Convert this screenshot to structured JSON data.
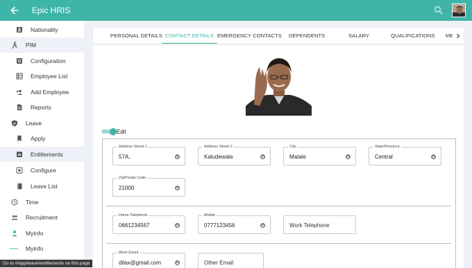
{
  "app": {
    "title": "Epic HRIS"
  },
  "sidebar": {
    "items": [
      {
        "label": "Nationality",
        "icon": "badge-icon",
        "level": 2
      },
      {
        "label": "PIM",
        "icon": "person-walk-icon",
        "level": 1
      },
      {
        "label": "Configuration",
        "icon": "settings-box-icon",
        "level": 2
      },
      {
        "label": "Employee List",
        "icon": "list-icon",
        "level": 2
      },
      {
        "label": "Add Employee",
        "icon": "person-add-icon",
        "level": 2
      },
      {
        "label": "Reports",
        "icon": "document-icon",
        "level": 2
      },
      {
        "label": "Leave",
        "icon": "shield-check-icon",
        "level": 1
      },
      {
        "label": "Apply",
        "icon": "bookmark-icon",
        "level": 2
      },
      {
        "label": "Entitlements",
        "icon": "bar-chart-icon",
        "level": 2
      },
      {
        "label": "Configure",
        "icon": "settings-box-icon",
        "level": 2
      },
      {
        "label": "Leave List",
        "icon": "book-icon",
        "level": 2
      },
      {
        "label": "Time",
        "icon": "clock-icon",
        "level": 1
      },
      {
        "label": "Recruitment",
        "icon": "people-icon",
        "level": 1
      },
      {
        "label": "MyInfo",
        "icon": "person-icon",
        "level": 1
      },
      {
        "label": "MyInfo",
        "icon": "dash-icon",
        "level": 2
      }
    ]
  },
  "status_bar": {
    "text": "Go to #/app/leave/entitlements on this page"
  },
  "tabs": [
    {
      "label": "PERSONAL DETAILS"
    },
    {
      "label": "CONTACT DETAILS"
    },
    {
      "label": "EMERGENCY CONTACTS"
    },
    {
      "label": "DEPENDENTS"
    },
    {
      "label": "SALARY"
    },
    {
      "label": "QUALIFICATIONS"
    },
    {
      "label": "ME"
    }
  ],
  "edit_toggle": {
    "label": "Edit"
  },
  "address": {
    "street1": {
      "label": "Address Street 1",
      "value": "57A,"
    },
    "street2": {
      "label": "Address Street 2",
      "value": "Kaludewala"
    },
    "city": {
      "label": "City",
      "value": "Matale"
    },
    "state": {
      "label": "State/Province",
      "value": "Central"
    },
    "zip": {
      "label": "Zip/Postal Code",
      "value": "21000"
    }
  },
  "phones": {
    "home": {
      "label": "Home Telephone",
      "value": "0661234567"
    },
    "mobile": {
      "label": "Mobile",
      "value": "0777123456"
    },
    "work": {
      "placeholder": "Work Telephone"
    }
  },
  "emails": {
    "work": {
      "label": "Work Email",
      "value": "dilax@gmail.com"
    },
    "other": {
      "placeholder": "Other Email"
    }
  },
  "colors": {
    "accent": "#3fb5a8",
    "active_bg": "#eef1f7"
  }
}
